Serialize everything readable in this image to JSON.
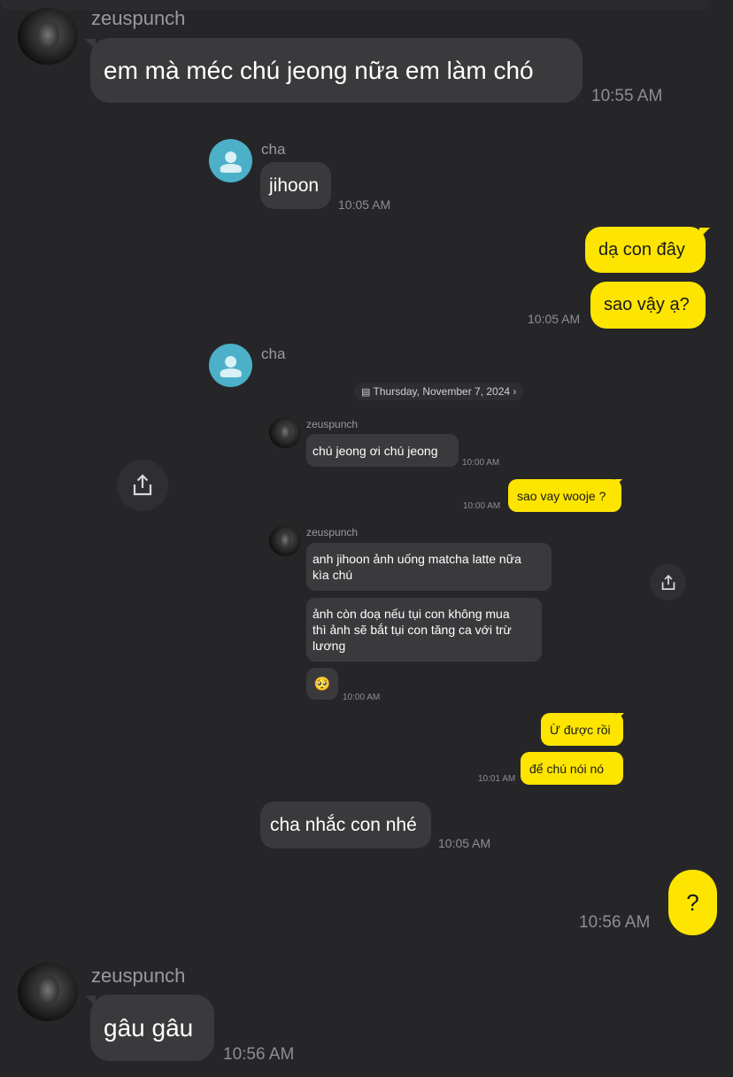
{
  "outer_chat": {
    "msg1": {
      "sender": "zeuspunch",
      "text": "em mà méc chú jeong nữa em làm chó",
      "time": "10:55 AM"
    },
    "msg_question": {
      "text": "?",
      "time": "10:56 AM"
    },
    "msg_last": {
      "sender": "zeuspunch",
      "text": "gâu gâu",
      "time": "10:56 AM"
    }
  },
  "forwarded": {
    "msg1": {
      "sender": "cha",
      "text": "jihoon",
      "time": "10:05 AM"
    },
    "out1": {
      "text": "dạ con đây"
    },
    "out2": {
      "text": "sao vậy ạ?",
      "time": "10:05 AM"
    },
    "cha2": {
      "sender": "cha"
    },
    "last": {
      "text": "cha nhắc con nhé",
      "time": "10:05 AM"
    }
  },
  "inner": {
    "date": "Thursday, November 7, 2024",
    "m1": {
      "sender": "zeuspunch",
      "text": "chú jeong ơi chú jeong",
      "time": "10:00 AM"
    },
    "o1": {
      "text": "sao vay wooje ?",
      "time": "10:00 AM"
    },
    "m2": {
      "sender": "zeuspunch",
      "line1": "anh jihoon ảnh uống matcha latte nữa",
      "line2": "kìa chú"
    },
    "m3": {
      "line1": "ảnh còn doạ nếu tụi con không mua",
      "line2": "thì ảnh sẽ bắt tụi con tăng ca với trừ",
      "line3": "lương"
    },
    "m4": {
      "emoji": "🥺",
      "time": "10:00 AM"
    },
    "o2": {
      "text": "Ừ được rồi"
    },
    "o3": {
      "text": "để chú nói nó",
      "time": "10:01 AM"
    }
  },
  "icons": [
    "share-icon",
    "calendar-icon",
    "chevron-right-icon",
    "default-avatar-icon"
  ],
  "colors": {
    "background": "#262628",
    "incoming_bubble": "#3a3a3d",
    "outgoing_bubble": "#fee500",
    "default_avatar": "#4bb0c8"
  }
}
